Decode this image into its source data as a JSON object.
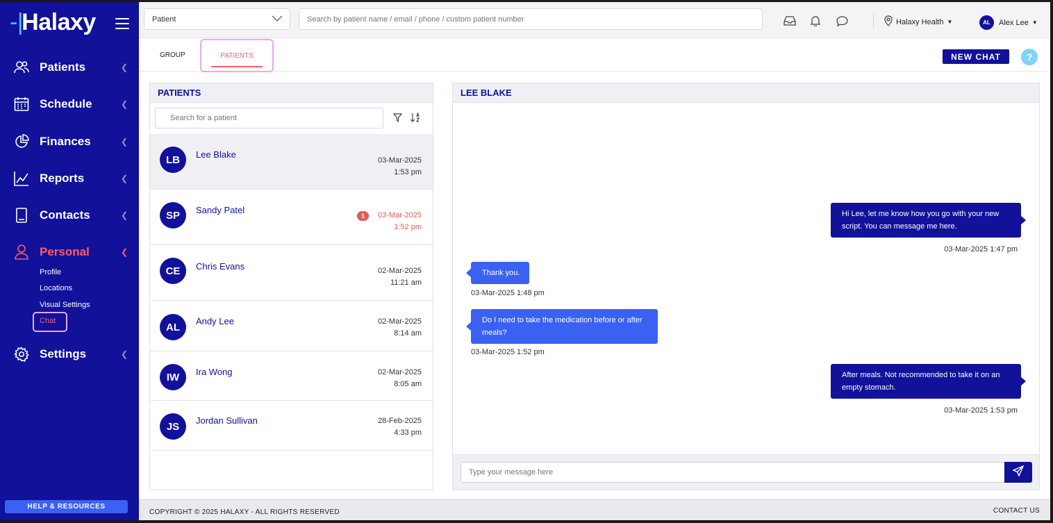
{
  "brand": {
    "logo_text": "Halaxy"
  },
  "sidebar": {
    "items": [
      {
        "label": "Patients"
      },
      {
        "label": "Schedule"
      },
      {
        "label": "Finances"
      },
      {
        "label": "Reports"
      },
      {
        "label": "Contacts"
      },
      {
        "label": "Personal"
      },
      {
        "label": "Settings"
      }
    ],
    "personal_sub": [
      "Profile",
      "Locations",
      "Visual Settings",
      "Chat"
    ],
    "help_label": "HELP & RESOURCES"
  },
  "topbar": {
    "select_value": "Patient",
    "search_placeholder": "Search by patient name / email / phone / custom patient number",
    "location": "Halaxy Health",
    "user_initials": "AL",
    "user_name": "Alex Lee"
  },
  "tabs": {
    "group": "GROUP",
    "patients": "PATIENTS"
  },
  "new_chat_label": "NEW CHAT",
  "help_q": "?",
  "patients_panel": {
    "title": "PATIENTS",
    "search_placeholder": "Search for a patient",
    "rows": [
      {
        "initials": "LB",
        "name": "Lee Blake",
        "date": "03-Mar-2025",
        "time": "1:53 pm"
      },
      {
        "initials": "SP",
        "name": "Sandy Patel",
        "date": "03-Mar-2025",
        "time": "1:52 pm",
        "unread": "1"
      },
      {
        "initials": "CE",
        "name": "Chris Evans",
        "date": "02-Mar-2025",
        "time": "11:21 am"
      },
      {
        "initials": "AL",
        "name": "Andy Lee",
        "date": "02-Mar-2025",
        "time": "8:14 am"
      },
      {
        "initials": "IW",
        "name": "Ira Wong",
        "date": "02-Mar-2025",
        "time": "8:05 am"
      },
      {
        "initials": "JS",
        "name": "Jordan Sullivan",
        "date": "28-Feb-2025",
        "time": "4:33 pm"
      }
    ]
  },
  "chat": {
    "title": "LEE BLAKE",
    "messages": [
      {
        "dir": "out",
        "text": "Hi Lee, let me know how you go with your new script. You can message me here.",
        "time": "03-Mar-2025 1:47 pm"
      },
      {
        "dir": "in",
        "text": "Thank you.",
        "time": "03-Mar-2025 1:48 pm"
      },
      {
        "dir": "in",
        "text": "Do I need to take the medication before or after meals?",
        "time": "03-Mar-2025 1:52 pm"
      },
      {
        "dir": "out",
        "text": "After meals. Not recommended to take it on an empty stomach.",
        "time": "03-Mar-2025 1:53 pm"
      }
    ],
    "input_placeholder": "Type your message here"
  },
  "footer": {
    "copyright": "COPYRIGHT © 2025 HALAXY - ALL RIGHTS RESERVED",
    "contact": "CONTACT US"
  },
  "colors": {
    "primary": "#11119a",
    "accent": "#ff5c6c",
    "bubble_in": "#3b61f2",
    "help": "#7fd3f5"
  }
}
